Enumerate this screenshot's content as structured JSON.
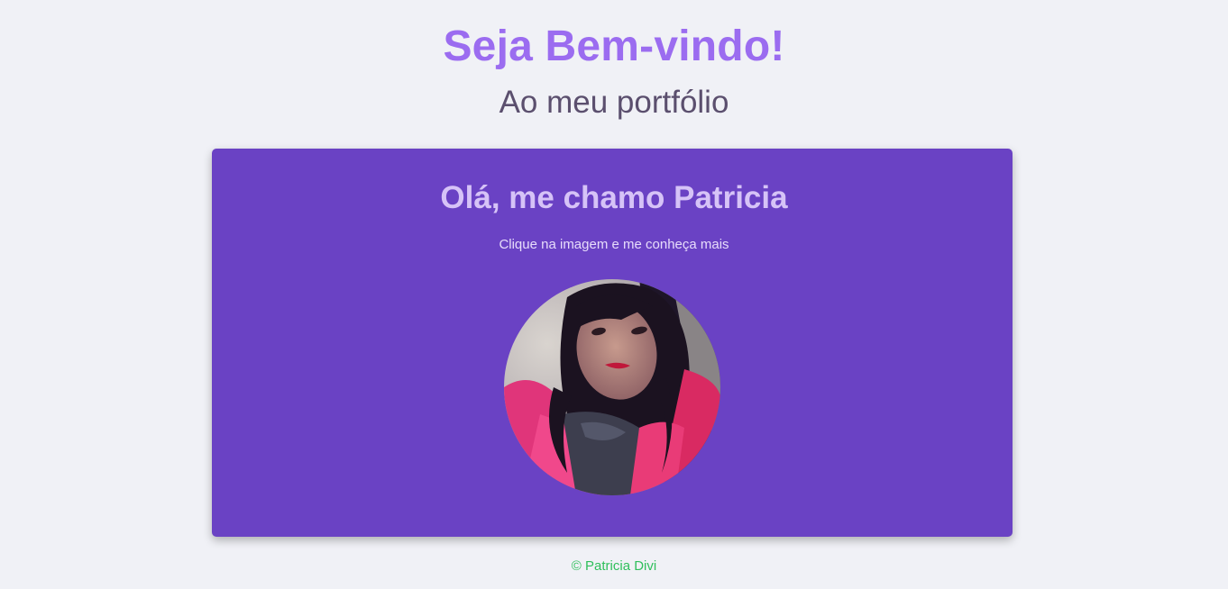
{
  "header": {
    "title": "Seja Bem-vindo!",
    "subtitle": "Ao meu portfólio"
  },
  "card": {
    "heading": "Olá, me chamo Patricia",
    "hint": "Clique na imagem e me conheça mais",
    "avatar_alt": "Patricia"
  },
  "footer": {
    "copyright": "© Patricia Divi"
  },
  "colors": {
    "page_background": "#f0f1f6",
    "title": "#9b6cf0",
    "subtitle": "#5b4f6e",
    "card_background": "#6a42c4",
    "card_heading": "#d6c3f7",
    "card_hint": "#e7dcfb",
    "footer": "#2fbf5b"
  }
}
